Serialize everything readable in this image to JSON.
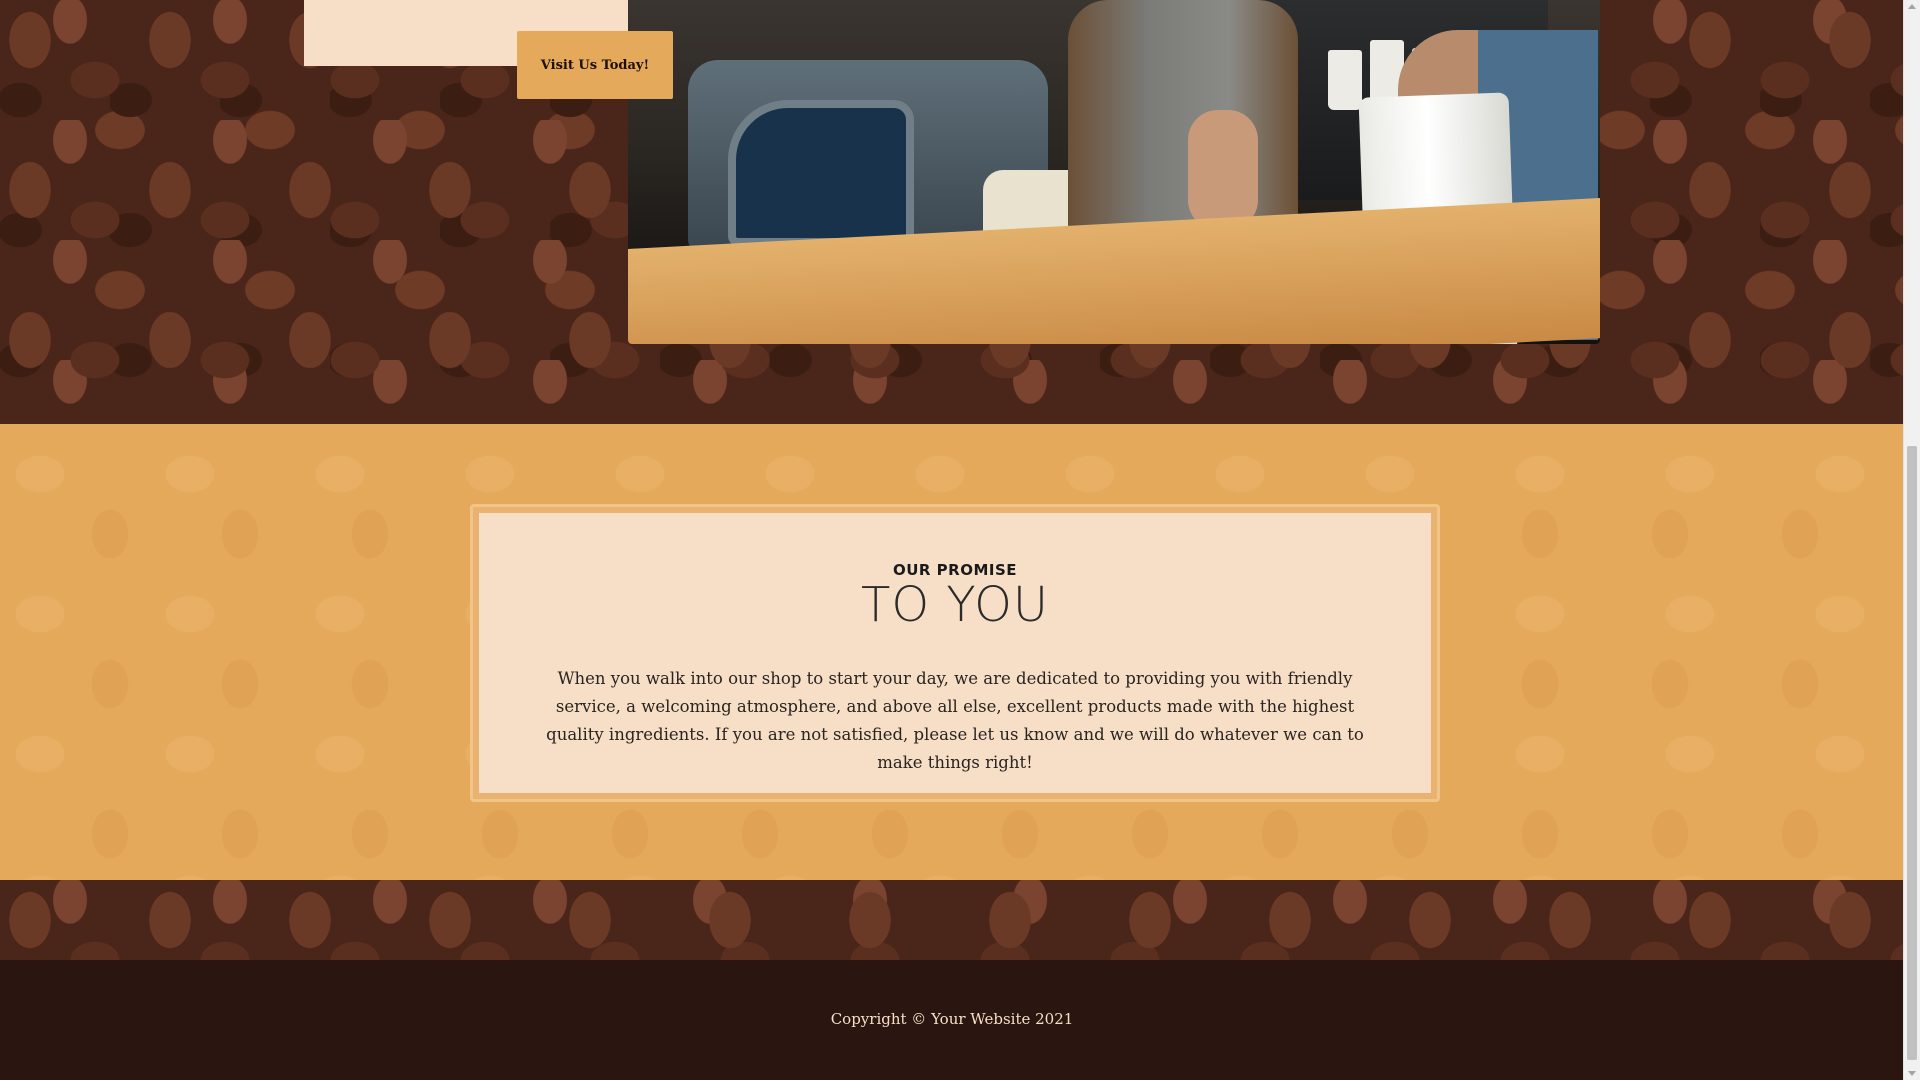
{
  "intro": {
    "button_label": "Visit Us Today!"
  },
  "photo": {
    "description_icon": "barista-photo"
  },
  "promise": {
    "subtitle": "OUR PROMISE",
    "title": "TO YOU",
    "text": "When you walk into our shop to start your day, we are dedicated to providing you with friendly service, a welcoming atmosphere, and above all else, excellent products made with the highest quality ingredients. If you are not satisfied, please let us know and we will do whatever we can to make things right!"
  },
  "footer": {
    "copyright": "Copyright © Your Website 2021"
  },
  "colors": {
    "accent": "#e5a95b",
    "card": "#f6dfc6",
    "footer_bg": "#2b1510",
    "bean_dark": "#4a2519"
  }
}
